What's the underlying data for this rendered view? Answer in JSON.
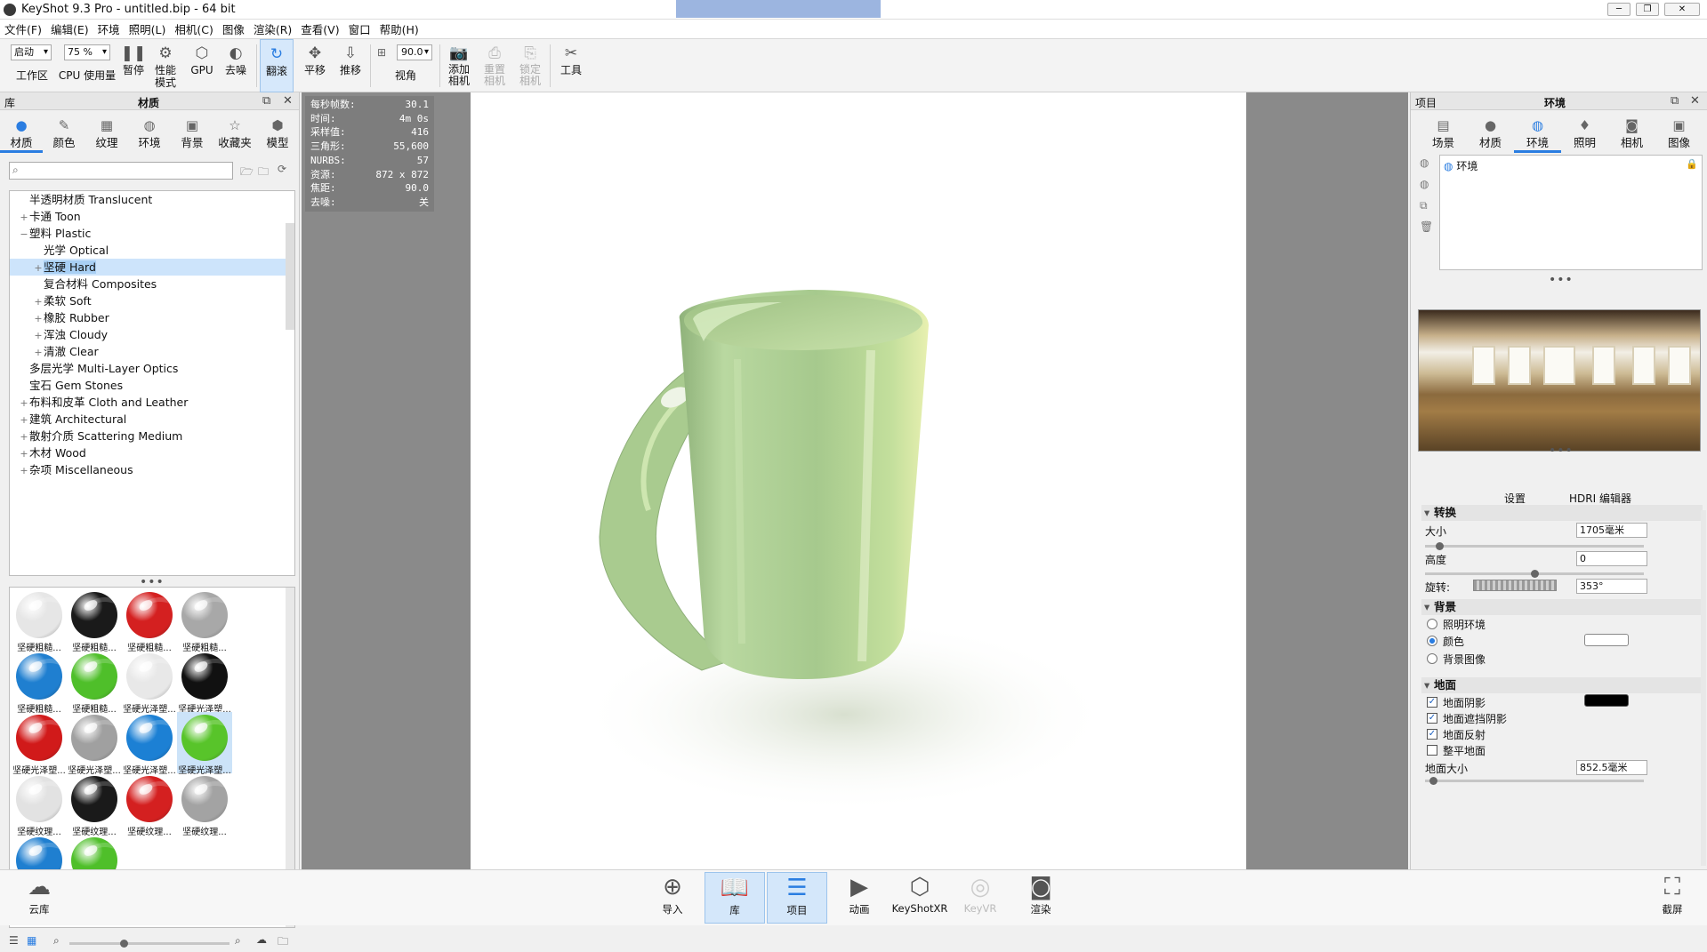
{
  "window": {
    "title": "KeyShot 9.3 Pro  - untitled.bip  - 64 bit"
  },
  "menu": [
    "文件(F)",
    "编辑(E)",
    "环境",
    "照明(L)",
    "相机(C)",
    "图像",
    "渲染(R)",
    "查看(V)",
    "窗口",
    "帮助(H)"
  ],
  "toolbar": {
    "workspace_select": "启动",
    "workspace_label": "工作区",
    "cpu_select": "75 %",
    "cpu_label": "CPU 使用量",
    "pause": "暂停",
    "perf_mode": "性能\n模式",
    "gpu": "GPU",
    "denoise": "去噪",
    "tumble": "翻滚",
    "pan": "平移",
    "dolly": "推移",
    "fov_value": "90.0",
    "fov_label": "视角",
    "add_camera": "添加\n相机",
    "reset_camera": "重置\n相机",
    "lock_camera": "锁定\n相机",
    "tools": "工具"
  },
  "library": {
    "header_left": "库",
    "header_title": "材质",
    "tabs": [
      "材质",
      "颜色",
      "纹理",
      "环境",
      "背景",
      "收藏夹",
      "模型"
    ],
    "tree": [
      {
        "label": "半透明材质 Translucent",
        "depth": 1,
        "exp": ""
      },
      {
        "label": "卡通 Toon",
        "depth": 1,
        "exp": "+"
      },
      {
        "label": "塑料 Plastic",
        "depth": 1,
        "exp": "−"
      },
      {
        "label": "光学 Optical",
        "depth": 2,
        "exp": ""
      },
      {
        "label": "坚硬 Hard",
        "depth": 2,
        "exp": "+",
        "selected": true
      },
      {
        "label": "复合材料 Composites",
        "depth": 2,
        "exp": ""
      },
      {
        "label": "柔软 Soft",
        "depth": 2,
        "exp": "+"
      },
      {
        "label": "橡胶 Rubber",
        "depth": 2,
        "exp": "+"
      },
      {
        "label": "浑浊 Cloudy",
        "depth": 2,
        "exp": "+"
      },
      {
        "label": "清澈 Clear",
        "depth": 2,
        "exp": "+"
      },
      {
        "label": "多层光学 Multi-Layer Optics",
        "depth": 1,
        "exp": ""
      },
      {
        "label": "宝石 Gem Stones",
        "depth": 1,
        "exp": ""
      },
      {
        "label": "布料和皮革 Cloth and Leather",
        "depth": 1,
        "exp": "+"
      },
      {
        "label": "建筑 Architectural",
        "depth": 1,
        "exp": "+"
      },
      {
        "label": "散射介质 Scattering Medium",
        "depth": 1,
        "exp": "+"
      },
      {
        "label": "木材 Wood",
        "depth": 1,
        "exp": "+"
      },
      {
        "label": "杂项 Miscellaneous",
        "depth": 1,
        "exp": "+"
      }
    ],
    "thumbnails": [
      {
        "label": "坚硬粗糙...",
        "color": "#e6e6e6"
      },
      {
        "label": "坚硬粗糙...",
        "color": "#1a1a1a"
      },
      {
        "label": "坚硬粗糙...",
        "color": "#d42020"
      },
      {
        "label": "坚硬粗糙...",
        "color": "#a8a8a8"
      },
      {
        "label": "坚硬粗糙...",
        "color": "#1f7fd0"
      },
      {
        "label": "坚硬粗糙...",
        "color": "#4fbf2a"
      },
      {
        "label": "坚硬光泽塑...",
        "color": "#e8e8e8"
      },
      {
        "label": "坚硬光泽塑...",
        "color": "#111111"
      },
      {
        "label": "坚硬光泽塑...",
        "color": "#d11a1a"
      },
      {
        "label": "坚硬光泽塑...",
        "color": "#a0a0a0"
      },
      {
        "label": "坚硬光泽塑...",
        "color": "#1c80d4"
      },
      {
        "label": "坚硬光泽塑...",
        "color": "#58c42a",
        "selected": true
      },
      {
        "label": "坚硬纹理...",
        "color": "#e2e2e2"
      },
      {
        "label": "坚硬纹理...",
        "color": "#1a1a1a"
      },
      {
        "label": "坚硬纹理...",
        "color": "#d42020"
      },
      {
        "label": "坚硬纹理...",
        "color": "#a3a3a3"
      },
      {
        "label": "",
        "color": "#1f7fd0"
      },
      {
        "label": "",
        "color": "#4fbf2a"
      }
    ]
  },
  "stats": [
    {
      "k": "每秒帧数:",
      "v": "30.1"
    },
    {
      "k": "时间:",
      "v": "4m 0s"
    },
    {
      "k": "采样值:",
      "v": "416"
    },
    {
      "k": "三角形:",
      "v": "55,600"
    },
    {
      "k": "NURBS:",
      "v": "57"
    },
    {
      "k": "资源:",
      "v": "872 x 872"
    },
    {
      "k": "焦距:",
      "v": "90.0"
    },
    {
      "k": "去噪:",
      "v": "关"
    }
  ],
  "project": {
    "header_left": "项目",
    "header_title": "环境",
    "tabs": [
      "场景",
      "材质",
      "环境",
      "照明",
      "相机",
      "图像"
    ],
    "env_item": "环境",
    "subtabs": {
      "settings": "设置",
      "hdri_editor": "HDRI 编辑器"
    },
    "transform": {
      "title": "转换",
      "size_label": "大小",
      "size_value": "1705毫米",
      "size_level": 0.05,
      "height_label": "高度",
      "height_value": "0",
      "height_level": 0.5,
      "rotation_label": "旋转:",
      "rotation_value": "353°"
    },
    "background": {
      "title": "背景",
      "opt1": "照明环境",
      "opt2": "颜色",
      "opt3": "背景图像"
    },
    "ground": {
      "title": "地面",
      "shadow": "地面阴影",
      "occlusion": "地面遮挡阴影",
      "reflect": "地面反射",
      "flatten": "整平地面",
      "size_label": "地面大小",
      "size_value": "852.5毫米",
      "size_level": 0.02
    }
  },
  "bottom": {
    "cloud": "云库",
    "import": "导入",
    "library": "库",
    "project": "项目",
    "animation": "动画",
    "keyshotxr": "KeyShotXR",
    "keyvr": "KeyVR",
    "render": "渲染",
    "screenshot": "截屏"
  },
  "colors": {
    "accent": "#2a7de1",
    "mug": "#a9cf8e"
  }
}
